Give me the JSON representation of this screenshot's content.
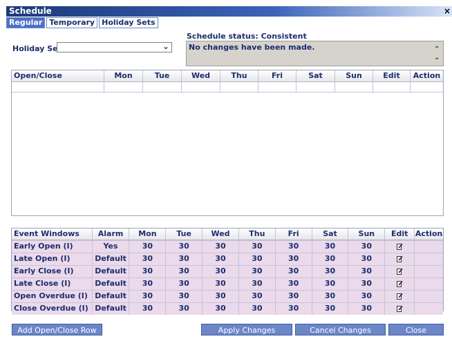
{
  "window": {
    "title": "Schedule",
    "close_glyph": "×"
  },
  "tabs": [
    {
      "label": "Regular",
      "active": true
    },
    {
      "label": "Temporary",
      "active": false
    },
    {
      "label": "Holiday Sets",
      "active": false
    }
  ],
  "holiday_set": {
    "label": "Holiday Set",
    "value": ""
  },
  "status": {
    "label": "Schedule status: Consistent",
    "message": "No changes have been made."
  },
  "open_close_table": {
    "columns": [
      "Open/Close",
      "Mon",
      "Tue",
      "Wed",
      "Thu",
      "Fri",
      "Sat",
      "Sun",
      "Edit",
      "Action"
    ]
  },
  "event_windows_table": {
    "columns": [
      "Event Windows",
      "Alarm",
      "Mon",
      "Tue",
      "Wed",
      "Thu",
      "Fri",
      "Sat",
      "Sun",
      "Edit",
      "Action"
    ],
    "rows": [
      {
        "name": "Early Open (I)",
        "alarm": "Yes",
        "mon": "30",
        "tue": "30",
        "wed": "30",
        "thu": "30",
        "fri": "30",
        "sat": "30",
        "sun": "30"
      },
      {
        "name": "Late Open (I)",
        "alarm": "Default",
        "mon": "30",
        "tue": "30",
        "wed": "30",
        "thu": "30",
        "fri": "30",
        "sat": "30",
        "sun": "30"
      },
      {
        "name": "Early Close (I)",
        "alarm": "Default",
        "mon": "30",
        "tue": "30",
        "wed": "30",
        "thu": "30",
        "fri": "30",
        "sat": "30",
        "sun": "30"
      },
      {
        "name": "Late Close (I)",
        "alarm": "Default",
        "mon": "30",
        "tue": "30",
        "wed": "30",
        "thu": "30",
        "fri": "30",
        "sat": "30",
        "sun": "30"
      },
      {
        "name": "Open Overdue (I)",
        "alarm": "Default",
        "mon": "30",
        "tue": "30",
        "wed": "30",
        "thu": "30",
        "fri": "30",
        "sat": "30",
        "sun": "30"
      },
      {
        "name": "Close Overdue (I)",
        "alarm": "Default",
        "mon": "30",
        "tue": "30",
        "wed": "30",
        "thu": "30",
        "fri": "30",
        "sat": "30",
        "sun": "30"
      }
    ]
  },
  "buttons": {
    "add_row": "Add Open/Close Row",
    "apply": "Apply Changes",
    "cancel": "Cancel Changes",
    "close": "Close"
  },
  "icons": {
    "edit": "edit-icon"
  }
}
